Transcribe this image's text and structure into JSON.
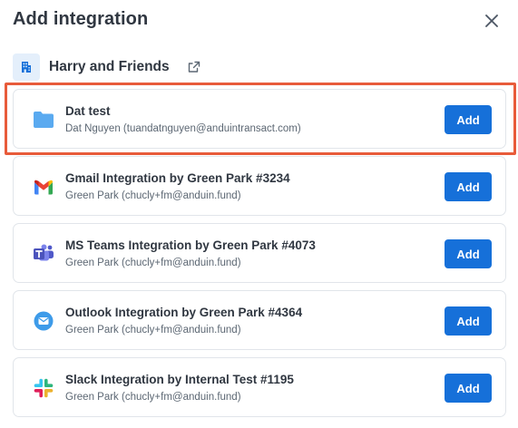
{
  "dialog": {
    "title": "Add integration",
    "close_icon": "close-icon"
  },
  "organization": {
    "name": "Harry and Friends",
    "icon": "building-icon",
    "link_icon": "external-link-icon"
  },
  "integrations": [
    {
      "title": "Dat test",
      "subtitle": "Dat Nguyen (tuandatnguyen@anduintransact.com)",
      "icon": "folder-icon",
      "button": "Add",
      "highlighted": true
    },
    {
      "title": "Gmail Integration by Green Park #3234",
      "subtitle": "Green Park (chucly+fm@anduin.fund)",
      "icon": "gmail-icon",
      "button": "Add"
    },
    {
      "title": "MS Teams Integration by Green Park #4073",
      "subtitle": "Green Park (chucly+fm@anduin.fund)",
      "icon": "ms-teams-icon",
      "button": "Add"
    },
    {
      "title": "Outlook Integration by Green Park #4364",
      "subtitle": "Green Park (chucly+fm@anduin.fund)",
      "icon": "outlook-icon",
      "button": "Add"
    },
    {
      "title": "Slack Integration by Internal Test #1195",
      "subtitle": "Green Park (chucly+fm@anduin.fund)",
      "icon": "slack-icon",
      "button": "Add"
    }
  ],
  "colors": {
    "primary_button": "#1670d9",
    "highlight_border": "#e85b3a",
    "folder": "#5aaaf0"
  }
}
